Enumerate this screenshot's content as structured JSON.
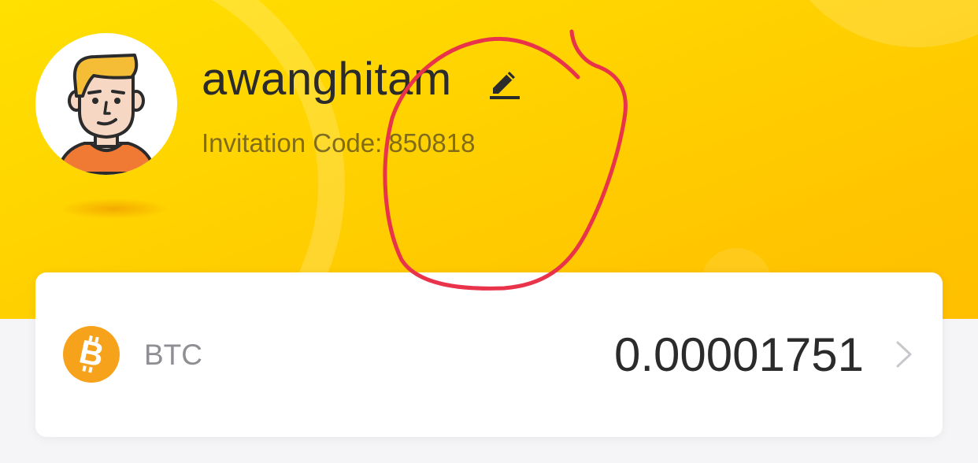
{
  "profile": {
    "username": "awanghitam",
    "invitation_label": "Invitation Code:",
    "invitation_code": "850818",
    "avatar_icon": "avatar-illustration",
    "edit_icon": "pencil-icon"
  },
  "wallet": {
    "coin_name": "BTC",
    "balance": "0.00001751",
    "coin_icon": "bitcoin-icon",
    "chevron_icon": "chevron-right-icon"
  },
  "colors": {
    "header_yellow": "#ffd400",
    "bitcoin_orange": "#f7a21b",
    "annotation_red": "#e8334a",
    "text_dark": "#2b2b2b",
    "text_gray": "#8e8e93"
  }
}
